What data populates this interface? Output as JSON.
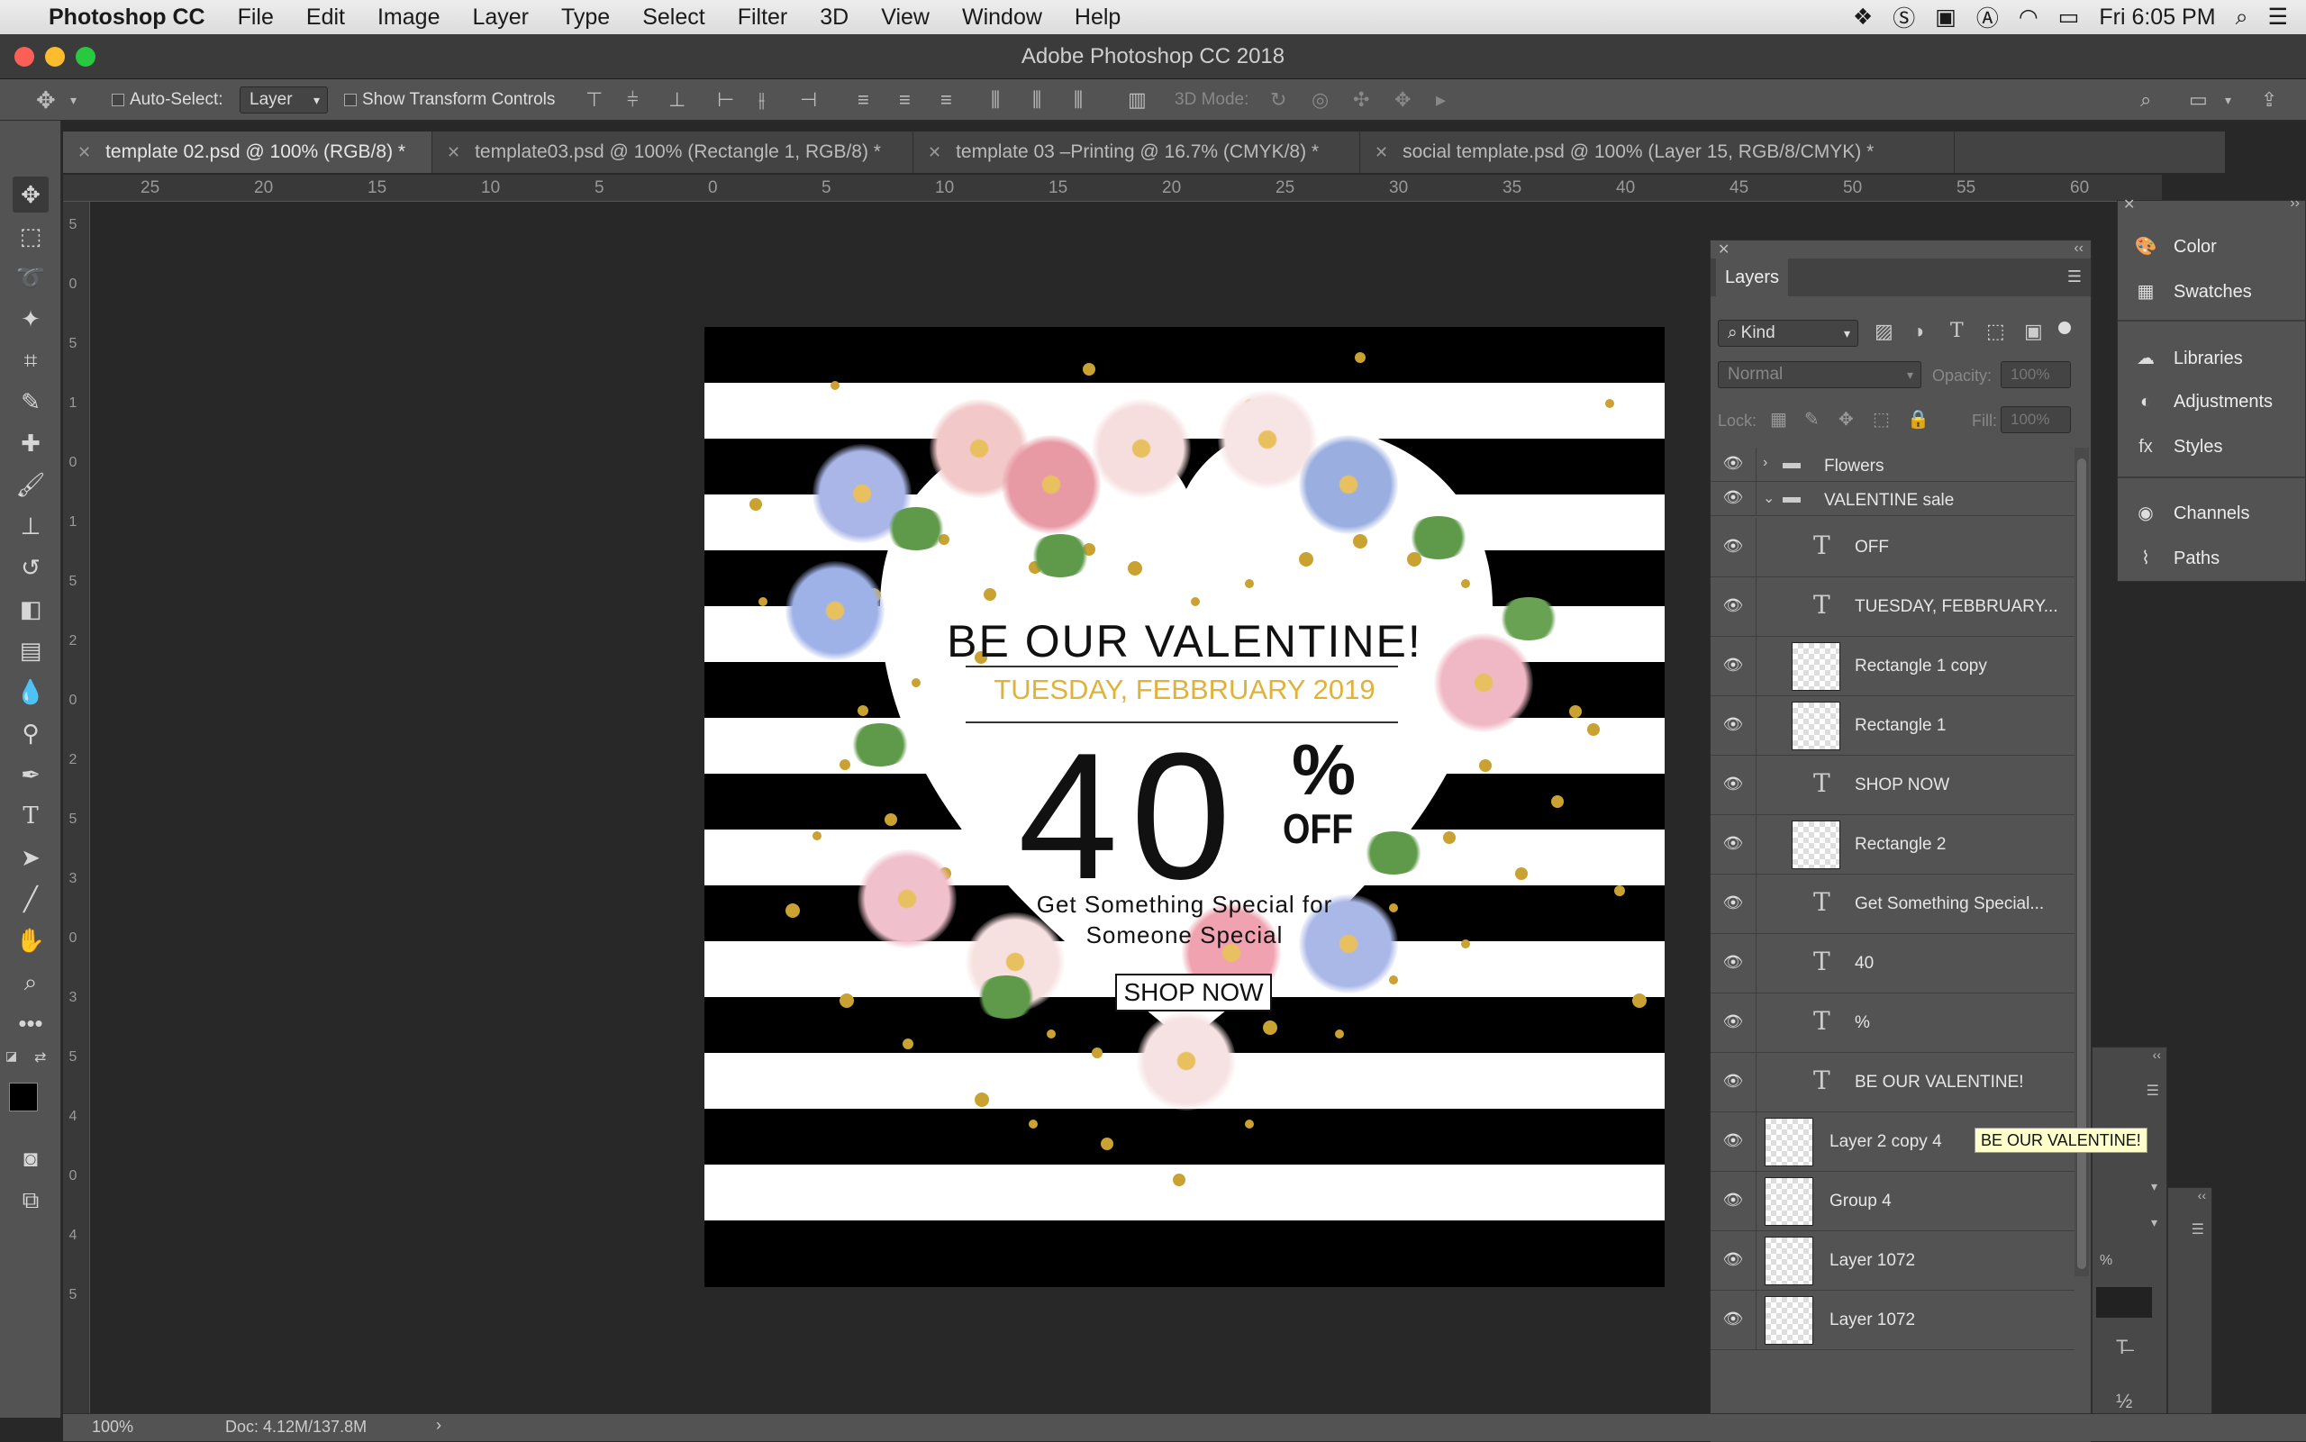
{
  "menubar": {
    "apple": "",
    "app": "Photoshop CC",
    "items": [
      "File",
      "Edit",
      "Image",
      "Layer",
      "Type",
      "Select",
      "Filter",
      "3D",
      "View",
      "Window",
      "Help"
    ],
    "clock": "Fri 6:05 PM"
  },
  "window": {
    "title": "Adobe Photoshop CC 2018"
  },
  "options": {
    "auto_select_label": "Auto-Select:",
    "auto_select_value": "Layer",
    "show_transform_label": "Show Transform Controls",
    "mode_3d_label": "3D Mode:"
  },
  "tabs": [
    {
      "label": "template 02.psd @ 100% (RGB/8) *"
    },
    {
      "label": "template03.psd @ 100% (Rectangle 1, RGB/8) *"
    },
    {
      "label": "template 03 –Printing @ 16.7% (CMYK/8) *"
    },
    {
      "label": "social template.psd @ 100% (Layer 15, RGB/8/CMYK) *"
    }
  ],
  "ruler": {
    "h": [
      "25",
      "20",
      "15",
      "10",
      "5",
      "0",
      "5",
      "10",
      "15",
      "20",
      "25",
      "30",
      "35",
      "40",
      "45",
      "50",
      "55",
      "60"
    ],
    "v": [
      "5",
      "0",
      "5",
      "1",
      "0",
      "1",
      "5",
      "2",
      "0",
      "2",
      "5",
      "3",
      "0",
      "3",
      "5",
      "4",
      "0",
      "4",
      "5"
    ]
  },
  "artwork": {
    "headline": "BE OUR VALENTINE!",
    "date": "TUESDAY, FEBBRUARY 2019",
    "number": "40",
    "percent": "%",
    "off": "OFF",
    "tagline_1": "Get Something Special for",
    "tagline_2": "Someone Special",
    "cta": "SHOP NOW"
  },
  "layers_panel": {
    "title": "Layers",
    "filter_kind": "Kind",
    "blend_mode": "Normal",
    "opacity_label": "Opacity:",
    "opacity_value": "100%",
    "lock_label": "Lock:",
    "fill_label": "Fill:",
    "fill_value": "100%",
    "rows": [
      {
        "name": "Flowers",
        "kind": "group"
      },
      {
        "name": "VALENTINE sale",
        "kind": "group-open"
      },
      {
        "name": "OFF",
        "kind": "text"
      },
      {
        "name": "TUESDAY, FEBBRUARY...",
        "kind": "text"
      },
      {
        "name": "Rectangle 1 copy",
        "kind": "shape"
      },
      {
        "name": "Rectangle 1",
        "kind": "shape"
      },
      {
        "name": "SHOP NOW",
        "kind": "text"
      },
      {
        "name": "Rectangle 2",
        "kind": "shape"
      },
      {
        "name": "Get Something Special...",
        "kind": "text"
      },
      {
        "name": "40",
        "kind": "text"
      },
      {
        "name": "%",
        "kind": "text"
      },
      {
        "name": "BE OUR VALENTINE!",
        "kind": "text"
      },
      {
        "name": "Layer 2 copy 4",
        "kind": "pixel"
      },
      {
        "name": "Group 4",
        "kind": "pixel"
      },
      {
        "name": "Layer 1072",
        "kind": "pixel"
      },
      {
        "name": "Layer 1072",
        "kind": "pixel"
      }
    ]
  },
  "side_panels": [
    {
      "label": "Color",
      "icon": "palette-icon"
    },
    {
      "label": "Swatches",
      "icon": "grid-icon"
    },
    {
      "label": "Libraries",
      "icon": "cloud-icon"
    },
    {
      "label": "Adjustments",
      "icon": "adjustments-icon"
    },
    {
      "label": "Styles",
      "icon": "fx-icon"
    },
    {
      "label": "Channels",
      "icon": "channels-icon"
    },
    {
      "label": "Paths",
      "icon": "paths-icon"
    }
  ],
  "tooltip": "BE OUR VALENTINE!",
  "status": {
    "zoom": "100%",
    "doc": "Doc: 4.12M/137.8M"
  },
  "colors": {
    "accent_gold": "#c9a232",
    "date_gold": "#e0b23a"
  }
}
